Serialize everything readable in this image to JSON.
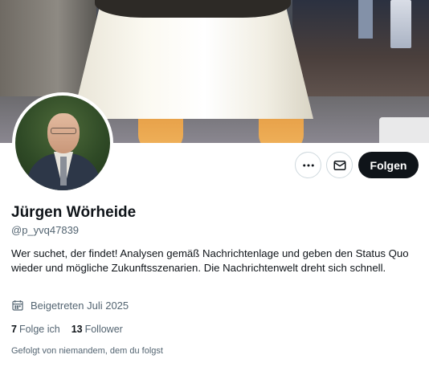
{
  "profile": {
    "display_name": "Jürgen Wörheide",
    "handle": "@p_yvq47839",
    "bio": "Wer suchet, der findet! Analysen gemäß Nachrichtenlage und geben den Status Quo wieder und mögliche Zukunftsszenarien. Die Nachrichtenwelt dreht sich schnell.",
    "joined": "Beigetreten Juli 2025",
    "following_count": "7",
    "following_label": "Folge ich",
    "followers_count": "13",
    "followers_label": "Follower",
    "followed_by": "Gefolgt von niemandem, dem du folgst"
  },
  "actions": {
    "more_icon": "more-horizontal-icon",
    "message_icon": "mail-icon",
    "follow_label": "Folgen"
  },
  "colors": {
    "primary_text": "#0f1419",
    "secondary_text": "#536471",
    "follow_button_bg": "#0f1419",
    "border": "#cfd9de"
  }
}
